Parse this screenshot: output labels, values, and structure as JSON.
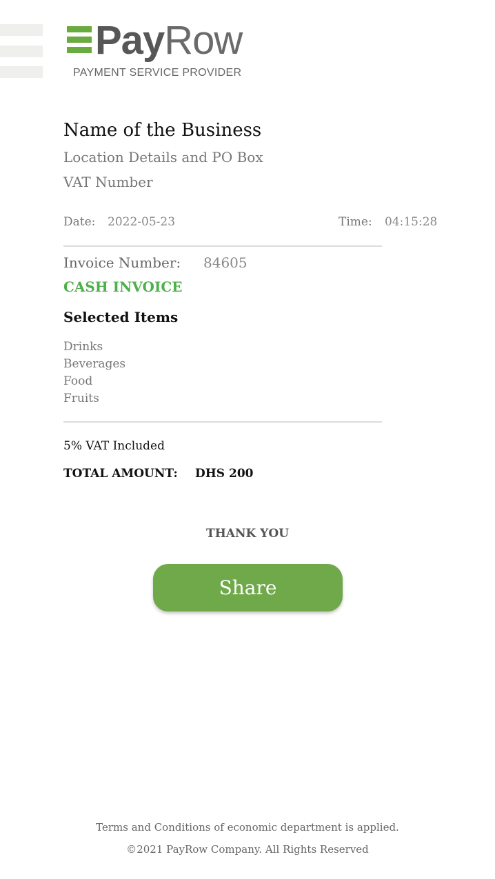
{
  "header": {
    "logo": {
      "pay": "Pay",
      "row": "Row",
      "subtitle": "PAYMENT SERVICE PROVIDER",
      "brand_color": "#6aaa3e"
    },
    "menu_icon": "hamburger-icon"
  },
  "business": {
    "name": "Name of the Business",
    "location": "Location Details and PO Box",
    "vat": "VAT Number"
  },
  "meta": {
    "date_label": "Date:",
    "date_value": "2022-05-23",
    "time_label": "Time:",
    "time_value": "04:15:28"
  },
  "invoice": {
    "number_label": "Invoice Number:",
    "number_value": "84605",
    "type": "CASH INVOICE",
    "type_color": "#4db04a",
    "selected_title": "Selected Items",
    "items": [
      "Drinks",
      "Beverages",
      "Food",
      "Fruits"
    ],
    "vat_note": "5% VAT Included",
    "total_label": "TOTAL AMOUNT:",
    "total_value": "DHS 200"
  },
  "thanks": "THANK YOU",
  "share_button": {
    "label": "Share",
    "color": "#6fa94a"
  },
  "footer": {
    "terms": "Terms and Conditions of economic department is applied.",
    "copyright": "©2021 PayRow Company. All Rights Reserved"
  }
}
